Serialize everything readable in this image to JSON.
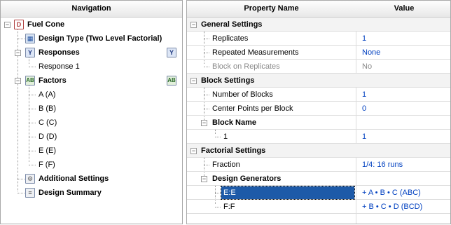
{
  "navigation": {
    "header": "Navigation",
    "root": "Fuel Cone",
    "design_type": "Design Type (Two Level Factorial)",
    "responses_label": "Responses",
    "response_items": [
      "Response 1"
    ],
    "factors_label": "Factors",
    "factor_items": [
      "A (A)",
      "B (B)",
      "C (C)",
      "D (D)",
      "E (E)",
      "F (F)"
    ],
    "additional_settings": "Additional Settings",
    "design_summary": "Design Summary"
  },
  "properties": {
    "header_name": "Property Name",
    "header_value": "Value",
    "general_settings": "General Settings",
    "replicates_label": "Replicates",
    "replicates_value": "1",
    "repeated_label": "Repeated Measurements",
    "repeated_value": "None",
    "block_rep_label": "Block on Replicates",
    "block_rep_value": "No",
    "block_settings": "Block Settings",
    "num_blocks_label": "Number of Blocks",
    "num_blocks_value": "1",
    "center_points_label": "Center Points per Block",
    "center_points_value": "0",
    "block_name_label": "Block Name",
    "block_name_item": "1",
    "block_name_value": "1",
    "factorial_settings": "Factorial Settings",
    "fraction_label": "Fraction",
    "fraction_value": "1/4: 16 runs",
    "design_generators": "Design Generators",
    "gen1_label": "E:E",
    "gen1_value": "+ A • B • C (ABC)",
    "gen2_label": "F:F",
    "gen2_value": "+ B • C • D (BCD)"
  },
  "icon_names": [
    "doc-icon",
    "design-icon",
    "responses-icon",
    "factors-icon",
    "settings-icon",
    "summary-icon"
  ],
  "colors": {
    "selection": "#1d5aa8",
    "value_blue": "#0040c0"
  }
}
